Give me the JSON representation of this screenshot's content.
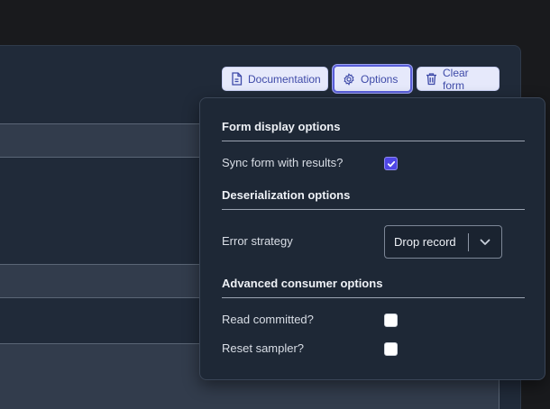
{
  "toolbar": {
    "documentation_label": "Documentation",
    "options_label": "Options",
    "clear_form_label": "Clear form"
  },
  "options_popover": {
    "form_display": {
      "title": "Form display options",
      "sync_label": "Sync form with results?",
      "sync_checked": true
    },
    "deserialization": {
      "title": "Deserialization options",
      "error_strategy_label": "Error strategy",
      "error_strategy_value": "Drop record"
    },
    "advanced_consumer": {
      "title": "Advanced consumer options",
      "read_committed_label": "Read committed?",
      "read_committed_checked": false,
      "reset_sampler_label": "Reset sampler?",
      "reset_sampler_checked": false
    }
  },
  "colors": {
    "accent": "#4f46e5",
    "button_bg": "#e6e9fb",
    "button_text": "#3e4aa8",
    "popover_bg": "#1e2836",
    "panel_bg": "#202a39"
  },
  "icons": [
    "document-icon",
    "gear-icon",
    "trash-icon",
    "checkmark-icon",
    "chevron-down-icon"
  ]
}
